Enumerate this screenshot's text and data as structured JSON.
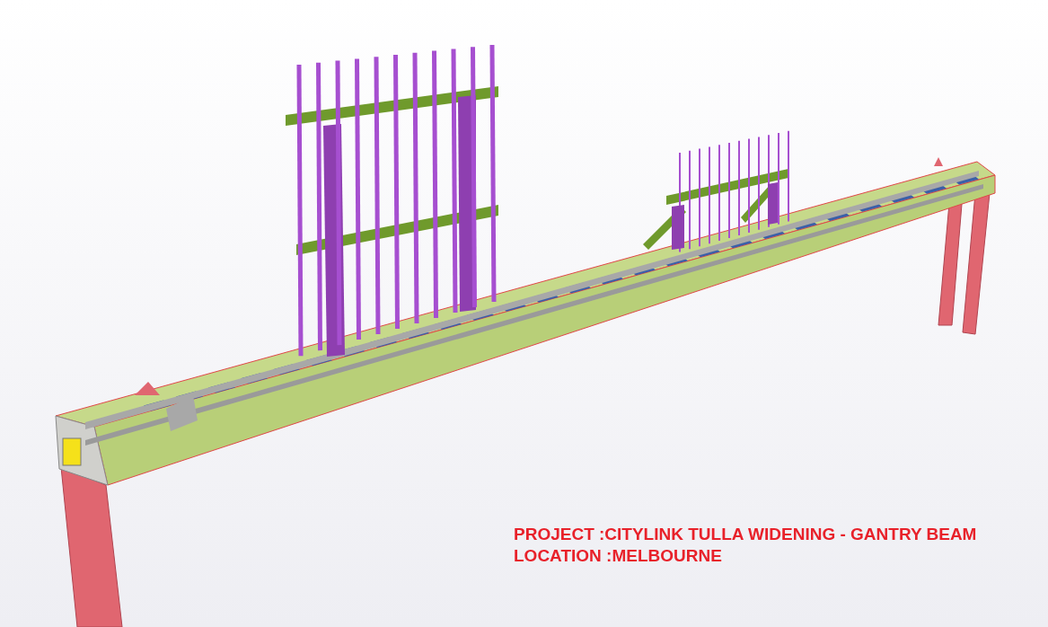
{
  "caption": {
    "lines": [
      "PROJECT :CITYLINK TULLA WIDENING - GANTRY BEAM",
      "LOCATION :MELBOURNE"
    ]
  }
}
